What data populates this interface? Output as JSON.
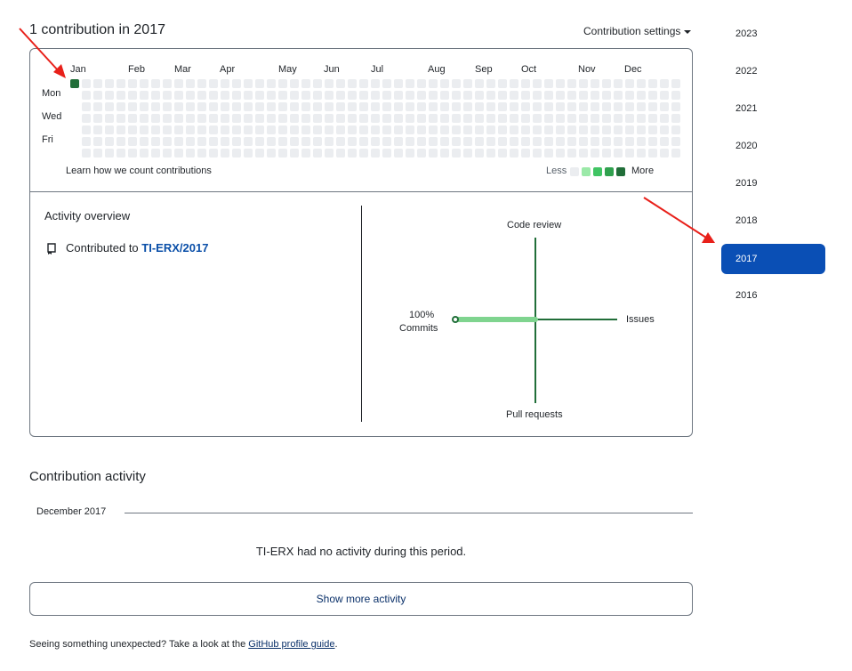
{
  "header": {
    "title": "1 contribution in 2017",
    "settings_label": "Contribution settings"
  },
  "calendar": {
    "months": [
      "Jan",
      "Feb",
      "Mar",
      "Apr",
      "May",
      "Jun",
      "Jul",
      "Aug",
      "Sep",
      "Oct",
      "Nov",
      "Dec"
    ],
    "day_labels": [
      "Mon",
      "Wed",
      "Fri"
    ],
    "weeks": 53,
    "contributions": [
      {
        "week": 0,
        "day": 0,
        "level": 4
      }
    ],
    "learn_link": "Learn how we count contributions",
    "legend_less": "Less",
    "legend_more": "More",
    "legend_colors": [
      "#ebedf0",
      "#9be9a8",
      "#40c463",
      "#30a14e",
      "#216e39"
    ]
  },
  "overview": {
    "title": "Activity overview",
    "contributed_prefix": "Contributed to",
    "repo": "TI-ERX/2017",
    "radar": {
      "axes": {
        "top": "Code review",
        "right": "Issues",
        "bottom": "Pull requests",
        "left": "Commits"
      },
      "values": {
        "commits": 100,
        "issues": 0,
        "code_review": 0,
        "pull_requests": 0
      },
      "left_percent": "100%",
      "color": "#216e39"
    }
  },
  "years": [
    "2023",
    "2022",
    "2021",
    "2020",
    "2019",
    "2018",
    "2017",
    "2016"
  ],
  "selected_year": "2017",
  "activity": {
    "title": "Contribution activity",
    "month": "December 2017",
    "no_activity": "TI-ERX had no activity during this period.",
    "show_more": "Show more activity"
  },
  "footer": {
    "prefix": "Seeing something unexpected? Take a look at the",
    "link": "GitHub profile guide",
    "suffix": "."
  },
  "annotation_color": "#e8201a"
}
